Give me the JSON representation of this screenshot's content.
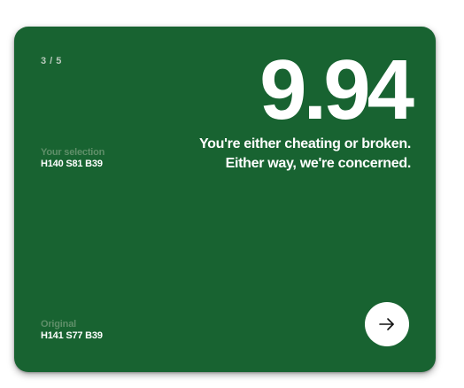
{
  "card": {
    "progress": "3 / 5",
    "score": "9.94",
    "message_line1": "You're either cheating or broken.",
    "message_line2": "Either way, we're concerned.",
    "selection": {
      "label": "Your selection",
      "value": "H140 S81 B39"
    },
    "original": {
      "label": "Original",
      "value": "H141 S77 B39"
    },
    "next_icon": "arrow-right-icon",
    "background_color": "#186331"
  }
}
